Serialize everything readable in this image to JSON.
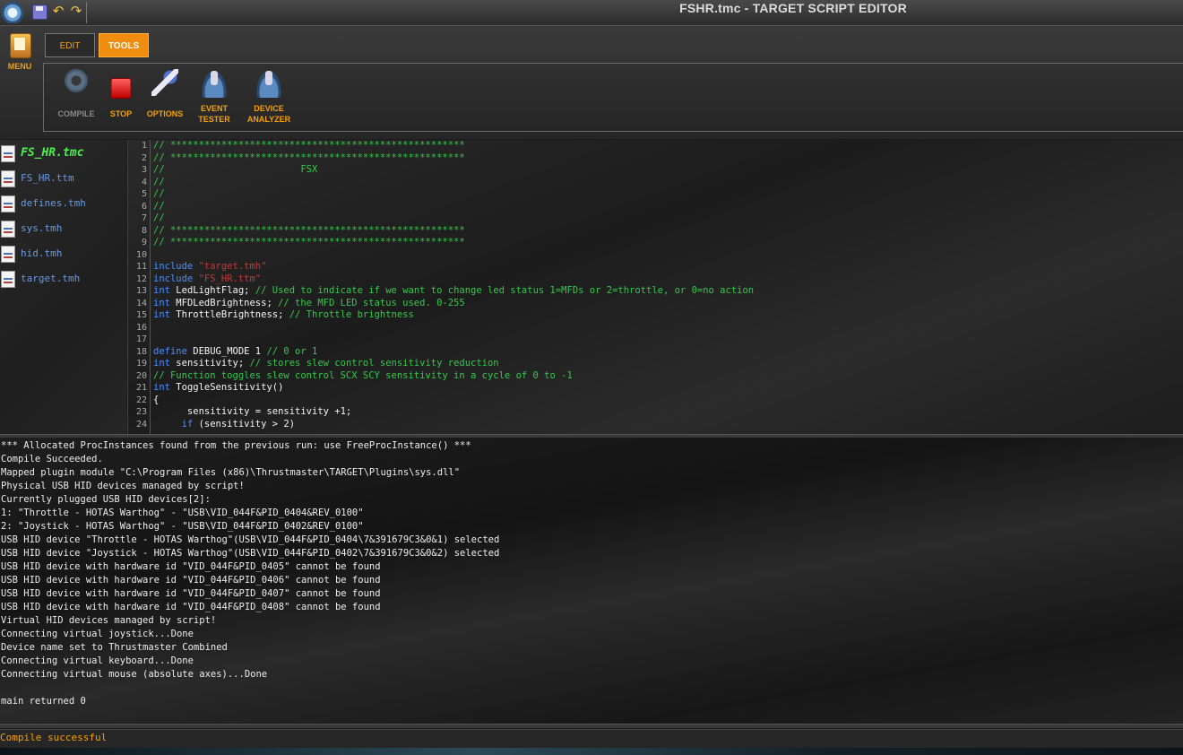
{
  "titlebar": {
    "title": "FSHR.tmc - TARGET SCRIPT EDITOR",
    "quick_access": [
      "save-icon",
      "undo-icon",
      "redo-icon"
    ]
  },
  "ribbon": {
    "menu_label": "MENU",
    "tabs": [
      {
        "label": "EDIT",
        "active": false
      },
      {
        "label": "TOOLS",
        "active": true
      }
    ],
    "tools": [
      {
        "label": "COMPILE",
        "icon": "gear-icon",
        "enabled": false
      },
      {
        "label": "STOP",
        "icon": "stop-icon",
        "enabled": true
      },
      {
        "label": "OPTIONS",
        "icon": "wrench-icon",
        "enabled": true
      },
      {
        "label1": "EVENT",
        "label2": "TESTER",
        "icon": "joystick-icon",
        "enabled": true
      },
      {
        "label1": "DEVICE",
        "label2": "ANALYZER",
        "icon": "joystick-icon",
        "enabled": true
      }
    ],
    "accent_color": "#f08c10"
  },
  "files": [
    "FS_HR.tmc",
    "FS_HR.ttm",
    "defines.tmh",
    "sys.tmh",
    "hid.tmh",
    "target.tmh"
  ],
  "editor": {
    "line_numbers": [
      "1",
      "2",
      "3",
      "4",
      "5",
      "6",
      "7",
      "8",
      "9",
      "10",
      "11",
      "12",
      "13",
      "14",
      "15",
      "16",
      "17",
      "18",
      "19",
      "20",
      "21",
      "22",
      "23",
      "24"
    ],
    "lines": [
      [
        {
          "t": "// ****************************************************",
          "c": "com"
        }
      ],
      [
        {
          "t": "// ****************************************************",
          "c": "com"
        }
      ],
      [
        {
          "t": "//                        FSX",
          "c": "com"
        }
      ],
      [
        {
          "t": "//",
          "c": "com"
        }
      ],
      [
        {
          "t": "//",
          "c": "com"
        }
      ],
      [
        {
          "t": "//",
          "c": "com"
        }
      ],
      [
        {
          "t": "//",
          "c": "com"
        }
      ],
      [
        {
          "t": "// ****************************************************",
          "c": "com"
        }
      ],
      [
        {
          "t": "// ****************************************************",
          "c": "com"
        }
      ],
      [],
      [
        {
          "t": "include ",
          "c": "kw"
        },
        {
          "t": "\"target.tmh\"",
          "c": "str"
        }
      ],
      [
        {
          "t": "include ",
          "c": "kw"
        },
        {
          "t": "\"FS_HR.ttm\"",
          "c": "str"
        }
      ],
      [
        {
          "t": "int ",
          "c": "kw"
        },
        {
          "t": "LedLightFlag; ",
          "c": "id"
        },
        {
          "t": "// Used to indicate if we want to change led status 1=MFDs or 2=throttle, or 0=no action",
          "c": "com"
        }
      ],
      [
        {
          "t": "int ",
          "c": "kw"
        },
        {
          "t": "MFDLedBrightness; ",
          "c": "id"
        },
        {
          "t": "// the MFD LED status used. 0-255",
          "c": "com"
        }
      ],
      [
        {
          "t": "int ",
          "c": "kw"
        },
        {
          "t": "ThrottleBrightness; ",
          "c": "id"
        },
        {
          "t": "// Throttle brightness",
          "c": "com"
        }
      ],
      [],
      [],
      [
        {
          "t": "define ",
          "c": "kw"
        },
        {
          "t": "DEBUG_MODE 1 ",
          "c": "id"
        },
        {
          "t": "// 0 or 1",
          "c": "com"
        }
      ],
      [
        {
          "t": "int ",
          "c": "kw"
        },
        {
          "t": "sensitivity; ",
          "c": "id"
        },
        {
          "t": "// stores slew control sensitivity reduction",
          "c": "com"
        }
      ],
      [
        {
          "t": "// Function toggles slew control SCX SCY sensitivity in a cycle of 0 to -1",
          "c": "com"
        }
      ],
      [
        {
          "t": "int ",
          "c": "kw"
        },
        {
          "t": "ToggleSensitivity()",
          "c": "id"
        }
      ],
      [
        {
          "t": "{",
          "c": "id"
        }
      ],
      [
        {
          "t": "      sensitivity = sensitivity +1;",
          "c": "id"
        }
      ],
      [
        {
          "t": "     ",
          "c": "id"
        },
        {
          "t": "if ",
          "c": "kw"
        },
        {
          "t": "(sensitivity > 2)",
          "c": "id"
        }
      ]
    ]
  },
  "output": [
    "*** Allocated ProcInstances found from the previous run: use FreeProcInstance() ***",
    "Compile Succeeded.",
    "Mapped plugin module \"C:\\Program Files (x86)\\Thrustmaster\\TARGET\\Plugins\\sys.dll\"",
    "Physical USB HID devices managed by script!",
    "Currently plugged USB HID devices[2]:",
    "1: \"Throttle - HOTAS Warthog\" - \"USB\\VID_044F&PID_0404&REV_0100\"",
    "2: \"Joystick - HOTAS Warthog\" - \"USB\\VID_044F&PID_0402&REV_0100\"",
    "USB HID device \"Throttle - HOTAS Warthog\"(USB\\VID_044F&PID_0404\\7&391679C3&0&1) selected",
    "USB HID device \"Joystick - HOTAS Warthog\"(USB\\VID_044F&PID_0402\\7&391679C3&0&2) selected",
    "USB HID device with hardware id \"VID_044F&PID_0405\" cannot be found",
    "USB HID device with hardware id \"VID_044F&PID_0406\" cannot be found",
    "USB HID device with hardware id \"VID_044F&PID_0407\" cannot be found",
    "USB HID device with hardware id \"VID_044F&PID_0408\" cannot be found",
    "Virtual HID devices managed by script!",
    "Connecting virtual joystick...Done",
    "Device name set to Thrustmaster Combined",
    "Connecting virtual keyboard...Done",
    "Connecting virtual mouse (absolute axes)...Done",
    "",
    "main returned 0"
  ],
  "status": {
    "text": "Compile successful",
    "color": "#f7a000"
  }
}
